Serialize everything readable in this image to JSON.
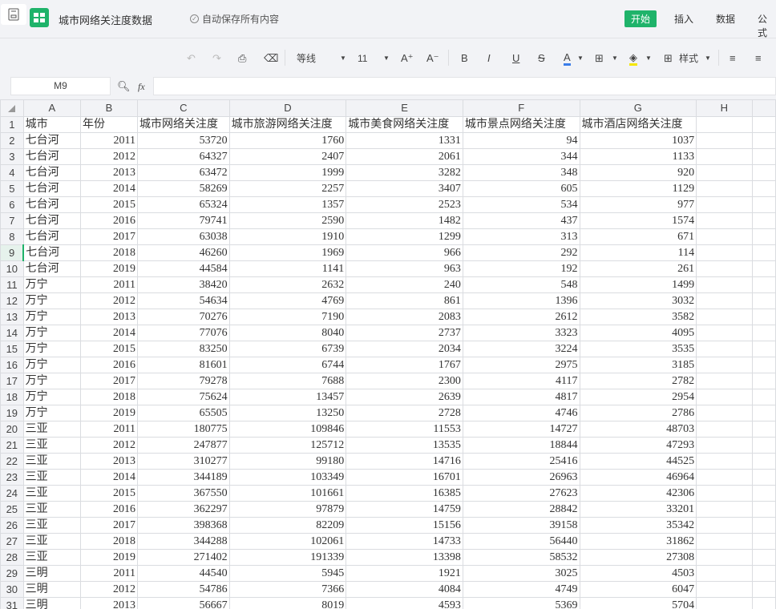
{
  "header": {
    "title": "城市网络关注度数据",
    "autosave": "自动保存所有内容",
    "menus": [
      "开始",
      "插入",
      "数据",
      "公式"
    ],
    "active_menu": "开始"
  },
  "toolbar": {
    "font": "等线",
    "font_size": "11",
    "style_label": "样式",
    "bold": "B",
    "italic": "I",
    "underline": "U",
    "strike": "S",
    "font_color": "A",
    "grow": "A⁺",
    "shrink": "A⁻",
    "accent": "#1fb36a",
    "font_color_bar": "#3b7de9",
    "fill_color_bar": "#f5e600"
  },
  "formula": {
    "cell": "M9",
    "fx": "fx",
    "value": ""
  },
  "columns": [
    "A",
    "B",
    "C",
    "D",
    "E",
    "F",
    "G",
    "H"
  ],
  "selected_row": 9,
  "rows": [
    [
      "城市",
      "年份",
      "城市网络关注度",
      "城市旅游网络关注度",
      "城市美食网络关注度",
      "城市景点网络关注度",
      "城市酒店网络关注度"
    ],
    [
      "七台河",
      "2011",
      "53720",
      "1760",
      "1331",
      "94",
      "1037"
    ],
    [
      "七台河",
      "2012",
      "64327",
      "2407",
      "2061",
      "344",
      "1133"
    ],
    [
      "七台河",
      "2013",
      "63472",
      "1999",
      "3282",
      "348",
      "920"
    ],
    [
      "七台河",
      "2014",
      "58269",
      "2257",
      "3407",
      "605",
      "1129"
    ],
    [
      "七台河",
      "2015",
      "65324",
      "1357",
      "2523",
      "534",
      "977"
    ],
    [
      "七台河",
      "2016",
      "79741",
      "2590",
      "1482",
      "437",
      "1574"
    ],
    [
      "七台河",
      "2017",
      "63038",
      "1910",
      "1299",
      "313",
      "671"
    ],
    [
      "七台河",
      "2018",
      "46260",
      "1969",
      "966",
      "292",
      "114"
    ],
    [
      "七台河",
      "2019",
      "44584",
      "1141",
      "963",
      "192",
      "261"
    ],
    [
      "万宁",
      "2011",
      "38420",
      "2632",
      "240",
      "548",
      "1499"
    ],
    [
      "万宁",
      "2012",
      "54634",
      "4769",
      "861",
      "1396",
      "3032"
    ],
    [
      "万宁",
      "2013",
      "70276",
      "7190",
      "2083",
      "2612",
      "3582"
    ],
    [
      "万宁",
      "2014",
      "77076",
      "8040",
      "2737",
      "3323",
      "4095"
    ],
    [
      "万宁",
      "2015",
      "83250",
      "6739",
      "2034",
      "3224",
      "3535"
    ],
    [
      "万宁",
      "2016",
      "81601",
      "6744",
      "1767",
      "2975",
      "3185"
    ],
    [
      "万宁",
      "2017",
      "79278",
      "7688",
      "2300",
      "4117",
      "2782"
    ],
    [
      "万宁",
      "2018",
      "75624",
      "13457",
      "2639",
      "4817",
      "2954"
    ],
    [
      "万宁",
      "2019",
      "65505",
      "13250",
      "2728",
      "4746",
      "2786"
    ],
    [
      "三亚",
      "2011",
      "180775",
      "109846",
      "11553",
      "14727",
      "48703"
    ],
    [
      "三亚",
      "2012",
      "247877",
      "125712",
      "13535",
      "18844",
      "47293"
    ],
    [
      "三亚",
      "2013",
      "310277",
      "99180",
      "14716",
      "25416",
      "44525"
    ],
    [
      "三亚",
      "2014",
      "344189",
      "103349",
      "16701",
      "26963",
      "46964"
    ],
    [
      "三亚",
      "2015",
      "367550",
      "101661",
      "16385",
      "27623",
      "42306"
    ],
    [
      "三亚",
      "2016",
      "362297",
      "97879",
      "14759",
      "28842",
      "33201"
    ],
    [
      "三亚",
      "2017",
      "398368",
      "82209",
      "15156",
      "39158",
      "35342"
    ],
    [
      "三亚",
      "2018",
      "344288",
      "102061",
      "14733",
      "56440",
      "31862"
    ],
    [
      "三亚",
      "2019",
      "271402",
      "191339",
      "13398",
      "58532",
      "27308"
    ],
    [
      "三明",
      "2011",
      "44540",
      "5945",
      "1921",
      "3025",
      "4503"
    ],
    [
      "三明",
      "2012",
      "54786",
      "7366",
      "4084",
      "4749",
      "6047"
    ],
    [
      "三明",
      "2013",
      "56667",
      "8019",
      "4593",
      "5369",
      "5704"
    ]
  ]
}
